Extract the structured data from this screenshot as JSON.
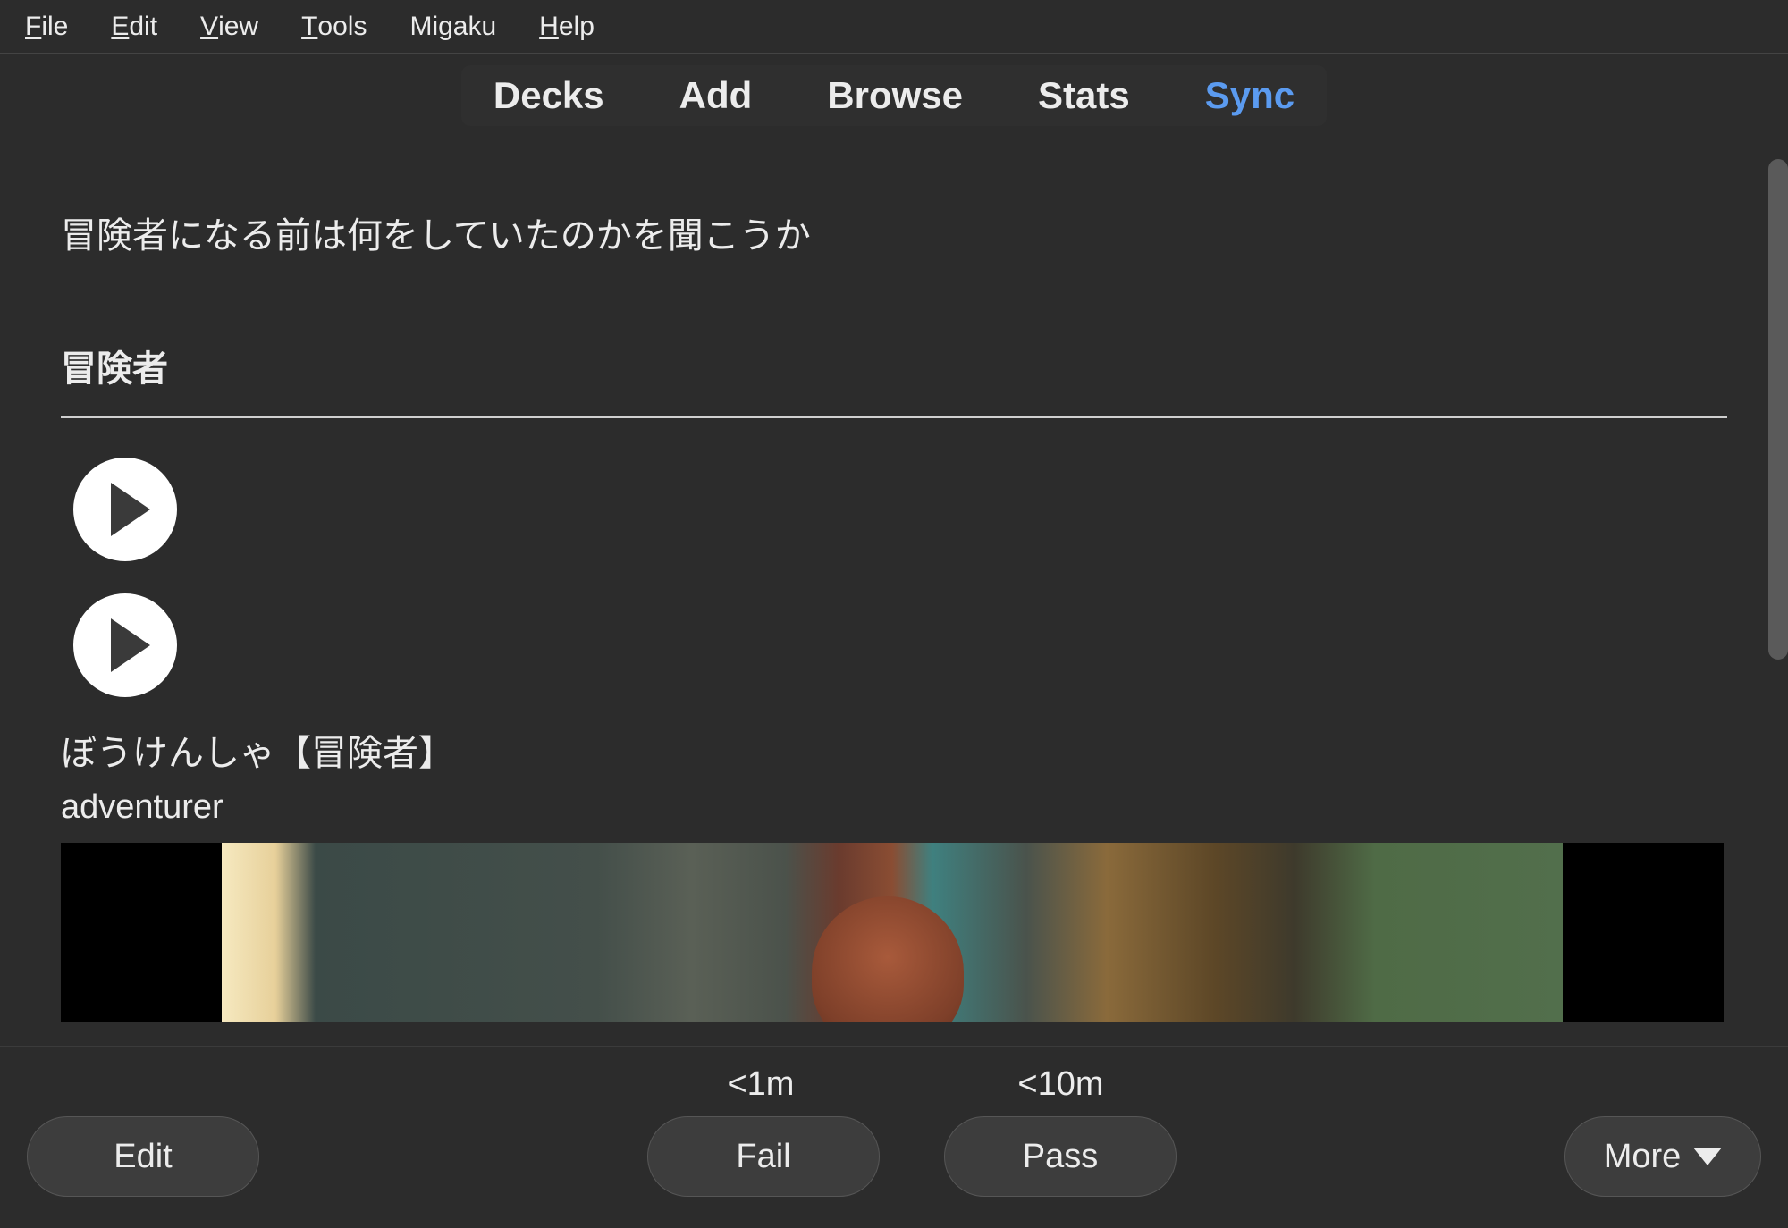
{
  "menubar": {
    "items": [
      {
        "u": "F",
        "rest": "ile"
      },
      {
        "u": "E",
        "rest": "dit"
      },
      {
        "u": "V",
        "rest": "iew"
      },
      {
        "u": "T",
        "rest": "ools"
      },
      {
        "plain": "Migaku"
      },
      {
        "u": "H",
        "rest": "elp"
      }
    ]
  },
  "tabs": {
    "decks": "Decks",
    "add": "Add",
    "browse": "Browse",
    "stats": "Stats",
    "sync": "Sync"
  },
  "card": {
    "sentence": "冒険者になる前は何をしていたのかを聞こうか",
    "term": "冒険者",
    "reading": "ぼうけんしゃ【冒険者】",
    "meaning": "adventurer"
  },
  "answer": {
    "intervals": {
      "fail": "<1m",
      "pass": "<10m"
    },
    "buttons": {
      "edit": "Edit",
      "fail": "Fail",
      "pass": "Pass",
      "more": "More"
    }
  }
}
